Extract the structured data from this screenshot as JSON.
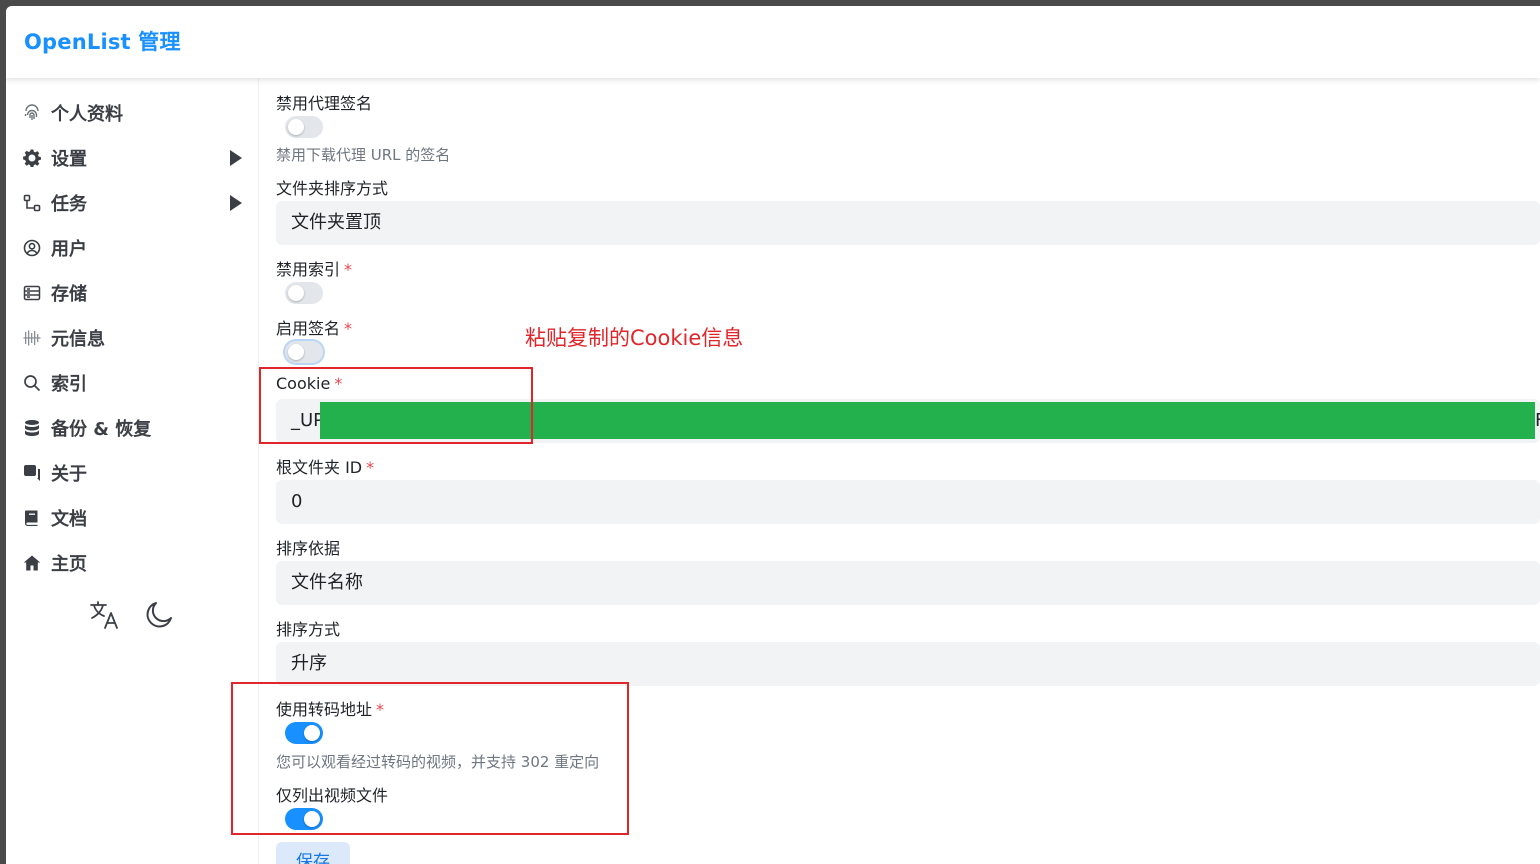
{
  "header": {
    "title": "OpenList 管理"
  },
  "sidebar": {
    "items": [
      {
        "label": "个人资料",
        "icon": "fingerprint-icon"
      },
      {
        "label": "设置",
        "icon": "gear-icon"
      },
      {
        "label": "任务",
        "icon": "task-tree-icon"
      },
      {
        "label": "用户",
        "icon": "user-circle-icon"
      },
      {
        "label": "存储",
        "icon": "storage-icon"
      },
      {
        "label": "元信息",
        "icon": "metadata-icon"
      },
      {
        "label": "索引",
        "icon": "search-icon"
      },
      {
        "label": "备份 & 恢复",
        "icon": "database-icon"
      },
      {
        "label": "关于",
        "icon": "about-icon"
      },
      {
        "label": "文档",
        "icon": "book-icon"
      },
      {
        "label": "主页",
        "icon": "home-icon"
      }
    ],
    "tools": {
      "translate_icon": "translate-icon",
      "theme_icon": "moon-icon"
    }
  },
  "form": {
    "disable_proxy_sign": {
      "label": "禁用代理签名",
      "hint": "禁用下载代理 URL 的签名",
      "enabled": false
    },
    "folder_sort": {
      "label": "文件夹排序方式",
      "value": "文件夹置顶"
    },
    "disable_index": {
      "label": "禁用索引",
      "required_mark": "*",
      "enabled": false
    },
    "enable_sign": {
      "label": "启用签名",
      "required_mark": "*",
      "enabled": false
    },
    "cookie": {
      "label": "Cookie",
      "required_mark": "*",
      "value_prefix": "_UP",
      "value_suffix": "F"
    },
    "root_folder_id": {
      "label": "根文件夹 ID",
      "required_mark": "*",
      "value": "0"
    },
    "order_by": {
      "label": "排序依据",
      "value": "文件名称"
    },
    "order_direction": {
      "label": "排序方式",
      "value": "升序"
    },
    "use_transcode": {
      "label": "使用转码地址",
      "required_mark": "*",
      "hint": "您可以观看经过转码的视频，并支持 302 重定向",
      "enabled": true
    },
    "only_list_video": {
      "label": "仅列出视频文件",
      "enabled": true
    },
    "save_label": "保存"
  },
  "annotation": {
    "text": "粘贴复制的Cookie信息",
    "color": "#e0262b"
  },
  "colors": {
    "accent": "#1890ff",
    "redaction": "#22b14c"
  }
}
